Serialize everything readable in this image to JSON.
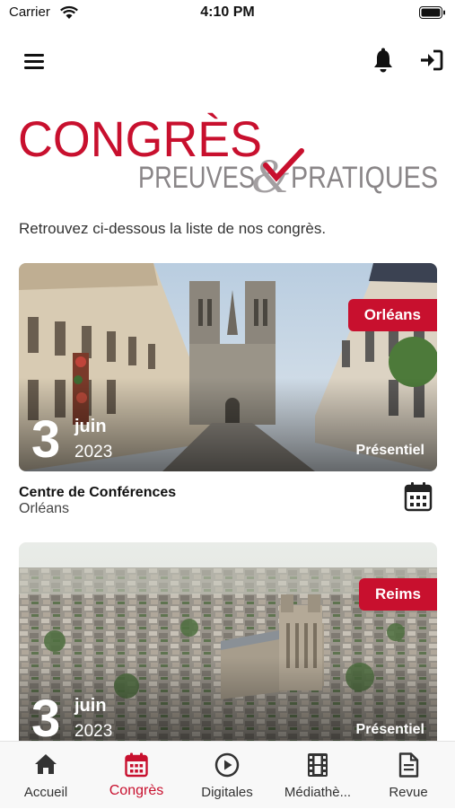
{
  "status_bar": {
    "carrier": "Carrier",
    "time": "4:10 PM"
  },
  "header": {
    "icons": [
      "menu-icon",
      "bell-icon",
      "login-icon"
    ]
  },
  "logo": {
    "line1": "CONGRÈS",
    "line2a": "PREUVES",
    "line2b": "PRATIQUES",
    "ampersand": "&"
  },
  "intro_text": "Retrouvez ci-dessous la liste de nos congrès.",
  "events": [
    {
      "city": "Orléans",
      "day": "3",
      "month": "juin",
      "year": "2023",
      "mode": "Présentiel",
      "venue": "Centre de Conférences",
      "venue_city": "Orléans"
    },
    {
      "city": "Reims",
      "day": "3",
      "month": "juin",
      "year": "2023",
      "mode": "Présentiel"
    }
  ],
  "tabs": [
    {
      "label": "Accueil",
      "icon": "home-icon"
    },
    {
      "label": "Congrès",
      "icon": "calendar-icon",
      "active": true
    },
    {
      "label": "Digitales",
      "icon": "play-icon"
    },
    {
      "label": "Médiathè...",
      "icon": "film-icon"
    },
    {
      "label": "Revue",
      "icon": "document-icon"
    }
  ],
  "colors": {
    "accent": "#c8102e",
    "logo_grey": "#8a8688"
  }
}
